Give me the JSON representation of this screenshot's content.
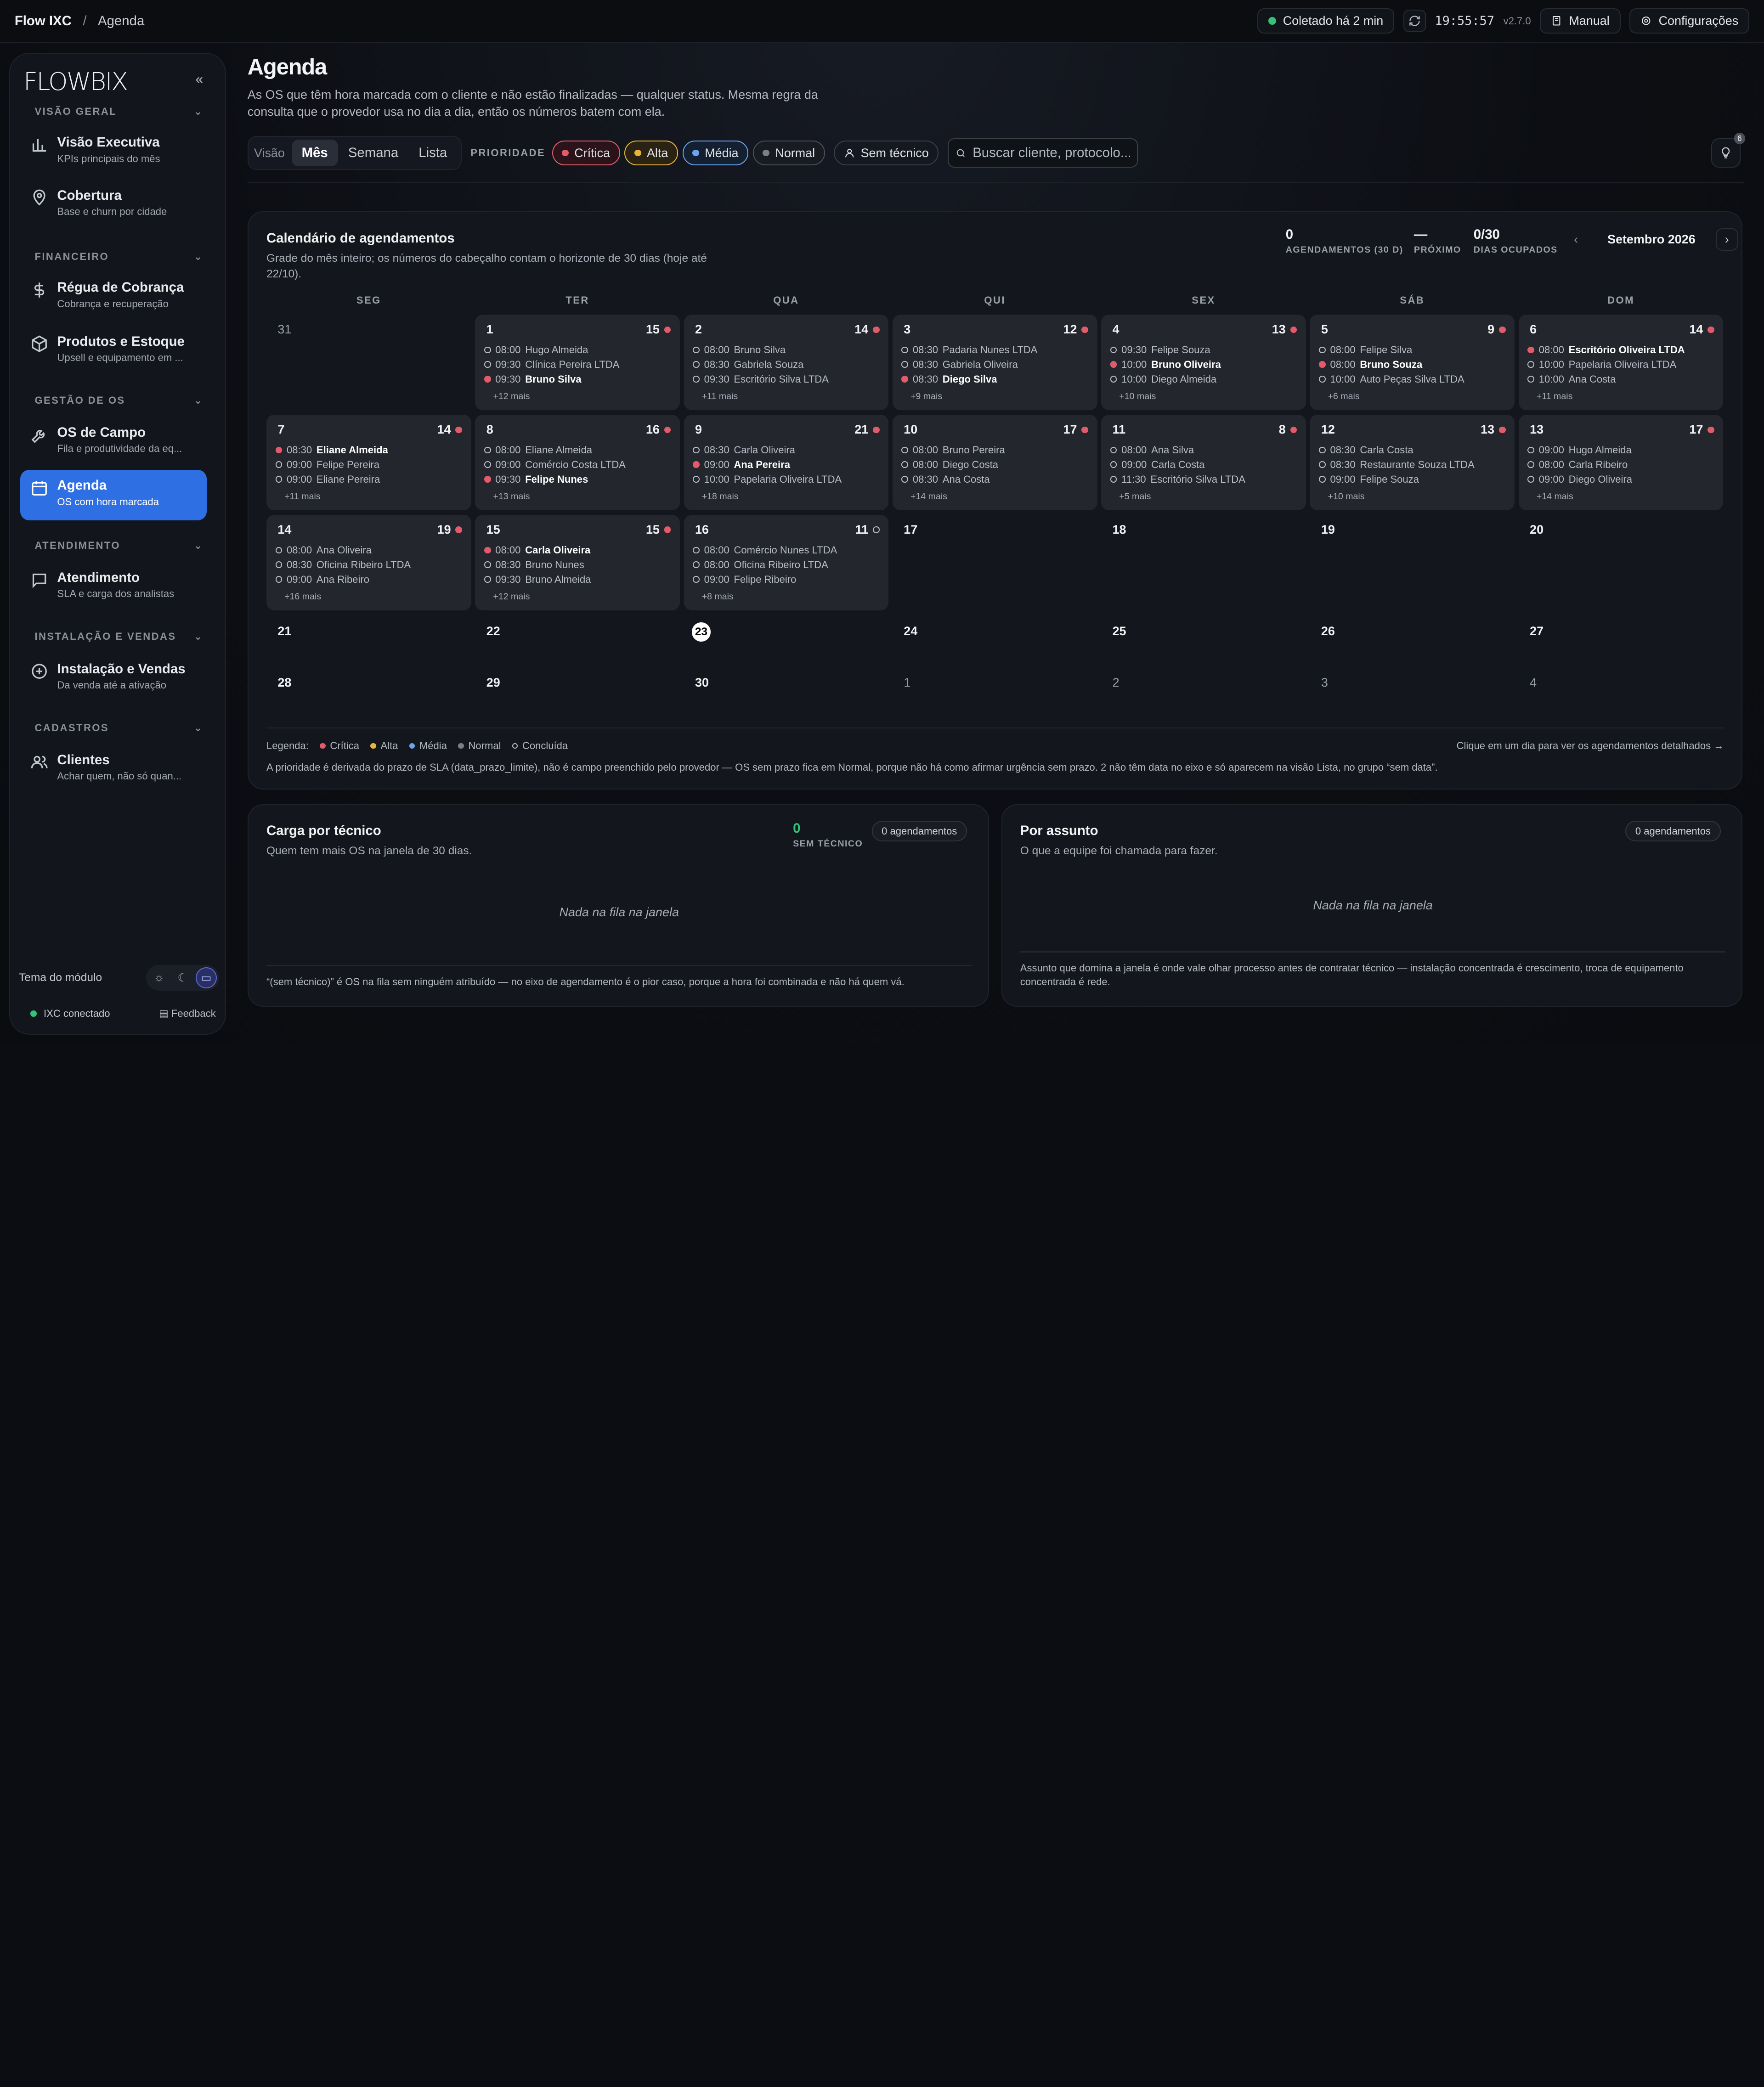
{
  "topbar": {
    "brand": "Flow IXC",
    "page": "Agenda",
    "status": "Coletado há 2 min",
    "status_color": "#33c27a",
    "clock": "19:55:57",
    "version": "v2.7.0",
    "manual": "Manual",
    "settings": "Configurações"
  },
  "sidebar": {
    "logo": "FLOWBIX",
    "sections": [
      {
        "title": "VISÃO GERAL"
      },
      {
        "title": "FINANCEIRO"
      },
      {
        "title": "GESTÃO DE OS"
      },
      {
        "title": "ATENDIMENTO"
      },
      {
        "title": "INSTALAÇÃO E VENDAS"
      },
      {
        "title": "CADASTROS"
      }
    ],
    "items": [
      {
        "title": "Visão Executiva",
        "sub": "KPIs principais do mês",
        "icon": "bar-chart-icon"
      },
      {
        "title": "Cobertura",
        "sub": "Base e churn por cidade",
        "icon": "map-pin-icon"
      },
      {
        "title": "Régua de Cobrança",
        "sub": "Cobrança e recuperação",
        "icon": "dollar-icon"
      },
      {
        "title": "Produtos e Estoque",
        "sub": "Upsell e equipamento em ...",
        "icon": "box-icon"
      },
      {
        "title": "OS de Campo",
        "sub": "Fila e produtividade da eq...",
        "icon": "wrench-icon"
      },
      {
        "title": "Agenda",
        "sub": "OS com hora marcada",
        "icon": "calendar-icon"
      },
      {
        "title": "Atendimento",
        "sub": "SLA e carga dos analistas",
        "icon": "chat-icon"
      },
      {
        "title": "Instalação e Vendas",
        "sub": "Da venda até a ativação",
        "icon": "plus-circle-icon"
      },
      {
        "title": "Clientes",
        "sub": "Achar quem, não só quan...",
        "icon": "users-icon"
      }
    ],
    "theme_label": "Tema do módulo",
    "connected": "IXC conectado",
    "feedback": "Feedback"
  },
  "main": {
    "title": "Agenda",
    "description": "As OS que têm hora marcada com o cliente e não estão finalizadas — qualquer status. Mesma regra da consulta que o provedor usa no dia a dia, então os números batem com ela.",
    "view_label": "Visão",
    "views": [
      "Mês",
      "Semana",
      "Lista"
    ],
    "priority_label": "PRIORIDADE",
    "priorities": [
      {
        "label": "Crítica",
        "color": "#e35b6b"
      },
      {
        "label": "Alta",
        "color": "#e8b43a"
      },
      {
        "label": "Média",
        "color": "#6aa4f0"
      },
      {
        "label": "Normal",
        "color": "#7a7f89"
      }
    ],
    "no_tech": "Sem técnico",
    "search_placeholder": "Buscar cliente, protocolo...",
    "tips_count": "6"
  },
  "calendar": {
    "title": "Calendário de agendamentos",
    "subtitle": "Grade do mês inteiro; os números do cabeçalho contam o horizonte de 30 dias (hoje até 22/10).",
    "stats": [
      {
        "value": "0",
        "label": "AGENDAMENTOS (30 D)"
      },
      {
        "value": "—",
        "label": "PRÓXIMO"
      },
      {
        "value": "0/30",
        "label": "DIAS OCUPADOS"
      }
    ],
    "month": "Setembro 2026",
    "weekdays": [
      "SEG",
      "TER",
      "QUA",
      "QUI",
      "SEX",
      "SÁB",
      "DOM"
    ],
    "days": [
      {
        "d": "31",
        "muted": true
      },
      {
        "d": "1",
        "count": "15",
        "events": [
          [
            "08:00",
            "Hugo Almeida",
            0
          ],
          [
            "09:30",
            "Clínica Pereira LTDA",
            0
          ],
          [
            "09:30",
            "Bruno Silva",
            1
          ]
        ],
        "more": "+12 mais"
      },
      {
        "d": "2",
        "count": "14",
        "events": [
          [
            "08:00",
            "Bruno Silva",
            0
          ],
          [
            "08:30",
            "Gabriela Souza",
            0
          ],
          [
            "09:30",
            "Escritório Silva LTDA",
            0
          ]
        ],
        "more": "+11 mais"
      },
      {
        "d": "3",
        "count": "12",
        "events": [
          [
            "08:30",
            "Padaria Nunes LTDA",
            0
          ],
          [
            "08:30",
            "Gabriela Oliveira",
            0
          ],
          [
            "08:30",
            "Diego Silva",
            1
          ]
        ],
        "more": "+9 mais"
      },
      {
        "d": "4",
        "count": "13",
        "events": [
          [
            "09:30",
            "Felipe Souza",
            0
          ],
          [
            "10:00",
            "Bruno Oliveira",
            1
          ],
          [
            "10:00",
            "Diego Almeida",
            0
          ]
        ],
        "more": "+10 mais"
      },
      {
        "d": "5",
        "count": "9",
        "events": [
          [
            "08:00",
            "Felipe Silva",
            0
          ],
          [
            "08:00",
            "Bruno Souza",
            1
          ],
          [
            "10:00",
            "Auto Peças Silva LTDA",
            0
          ]
        ],
        "more": "+6 mais"
      },
      {
        "d": "6",
        "count": "14",
        "events": [
          [
            "08:00",
            "Escritório Oliveira LTDA",
            1
          ],
          [
            "10:00",
            "Papelaria Oliveira LTDA",
            0
          ],
          [
            "10:00",
            "Ana Costa",
            0
          ]
        ],
        "more": "+11 mais"
      },
      {
        "d": "7",
        "count": "14",
        "events": [
          [
            "08:30",
            "Eliane Almeida",
            1
          ],
          [
            "09:00",
            "Felipe Pereira",
            0
          ],
          [
            "09:00",
            "Eliane Pereira",
            0
          ]
        ],
        "more": "+11 mais"
      },
      {
        "d": "8",
        "count": "16",
        "events": [
          [
            "08:00",
            "Eliane Almeida",
            0
          ],
          [
            "09:00",
            "Comércio Costa LTDA",
            0
          ],
          [
            "09:30",
            "Felipe Nunes",
            1
          ]
        ],
        "more": "+13 mais"
      },
      {
        "d": "9",
        "count": "21",
        "events": [
          [
            "08:30",
            "Carla Oliveira",
            0
          ],
          [
            "09:00",
            "Ana Pereira",
            1
          ],
          [
            "10:00",
            "Papelaria Oliveira LTDA",
            0
          ]
        ],
        "more": "+18 mais"
      },
      {
        "d": "10",
        "count": "17",
        "events": [
          [
            "08:00",
            "Bruno Pereira",
            0
          ],
          [
            "08:00",
            "Diego Costa",
            0
          ],
          [
            "08:30",
            "Ana Costa",
            0
          ]
        ],
        "more": "+14 mais"
      },
      {
        "d": "11",
        "count": "8",
        "events": [
          [
            "08:00",
            "Ana Silva",
            0
          ],
          [
            "09:00",
            "Carla Costa",
            0
          ],
          [
            "11:30",
            "Escritório Silva LTDA",
            0
          ]
        ],
        "more": "+5 mais"
      },
      {
        "d": "12",
        "count": "13",
        "events": [
          [
            "08:30",
            "Carla Costa",
            0
          ],
          [
            "08:30",
            "Restaurante Souza LTDA",
            0
          ],
          [
            "09:00",
            "Felipe Souza",
            0
          ]
        ],
        "more": "+10 mais"
      },
      {
        "d": "13",
        "count": "17",
        "events": [
          [
            "09:00",
            "Hugo Almeida",
            0
          ],
          [
            "08:00",
            "Carla Ribeiro",
            0
          ],
          [
            "09:00",
            "Diego Oliveira",
            0
          ]
        ],
        "more": "+14 mais"
      },
      {
        "d": "14",
        "count": "19",
        "events": [
          [
            "08:00",
            "Ana Oliveira",
            0
          ],
          [
            "08:30",
            "Oficina Ribeiro LTDA",
            0
          ],
          [
            "09:00",
            "Ana Ribeiro",
            0
          ]
        ],
        "more": "+16 mais"
      },
      {
        "d": "15",
        "count": "15",
        "events": [
          [
            "08:00",
            "Carla Oliveira",
            1
          ],
          [
            "08:30",
            "Bruno Nunes",
            0
          ],
          [
            "09:30",
            "Bruno Almeida",
            0
          ]
        ],
        "more": "+12 mais"
      },
      {
        "d": "16",
        "count": "11",
        "open": true,
        "events": [
          [
            "08:00",
            "Comércio Nunes LTDA",
            0
          ],
          [
            "08:00",
            "Oficina Ribeiro LTDA",
            0
          ],
          [
            "09:00",
            "Felipe Ribeiro",
            0
          ]
        ],
        "more": "+8 mais"
      },
      {
        "d": "17"
      },
      {
        "d": "18"
      },
      {
        "d": "19"
      },
      {
        "d": "20"
      },
      {
        "d": "21"
      },
      {
        "d": "22"
      },
      {
        "d": "23",
        "today": true
      },
      {
        "d": "24"
      },
      {
        "d": "25"
      },
      {
        "d": "26"
      },
      {
        "d": "27"
      },
      {
        "d": "28"
      },
      {
        "d": "29"
      },
      {
        "d": "30"
      },
      {
        "d": "1",
        "muted": true
      },
      {
        "d": "2",
        "muted": true
      },
      {
        "d": "3",
        "muted": true
      },
      {
        "d": "4",
        "muted": true
      }
    ],
    "legend_label": "Legenda:",
    "legend": [
      "Crítica",
      "Alta",
      "Média",
      "Normal",
      "Concluída"
    ],
    "legend_hint": "Clique em um dia para ver os agendamentos detalhados →",
    "note": "A prioridade é derivada do prazo de SLA (data_prazo_limite), não é campo preenchido pelo provedor — OS sem prazo fica em Normal, porque não há como afirmar urgência sem prazo. 2 não têm data no eixo e só aparecem na visão Lista, no grupo “sem data”."
  },
  "load": {
    "title": "Carga por técnico",
    "subtitle": "Quem tem mais OS na janela de 30 dias.",
    "no_tech_value": "0",
    "no_tech_label": "SEM TÉCNICO",
    "badge": "0 agendamentos",
    "empty": "Nada na fila na janela",
    "note": "“(sem técnico)” é OS na fila sem ninguém atribuído — no eixo de agendamento é o pior caso, porque a hora foi combinada e não há quem vá."
  },
  "subject": {
    "title": "Por assunto",
    "subtitle": "O que a equipe foi chamada para fazer.",
    "badge": "0 agendamentos",
    "empty": "Nada na fila na janela",
    "note": "Assunto que domina a janela é onde vale olhar processo antes de contratar técnico — instalação concentrada é crescimento, troca de equipamento concentrada é rede."
  }
}
